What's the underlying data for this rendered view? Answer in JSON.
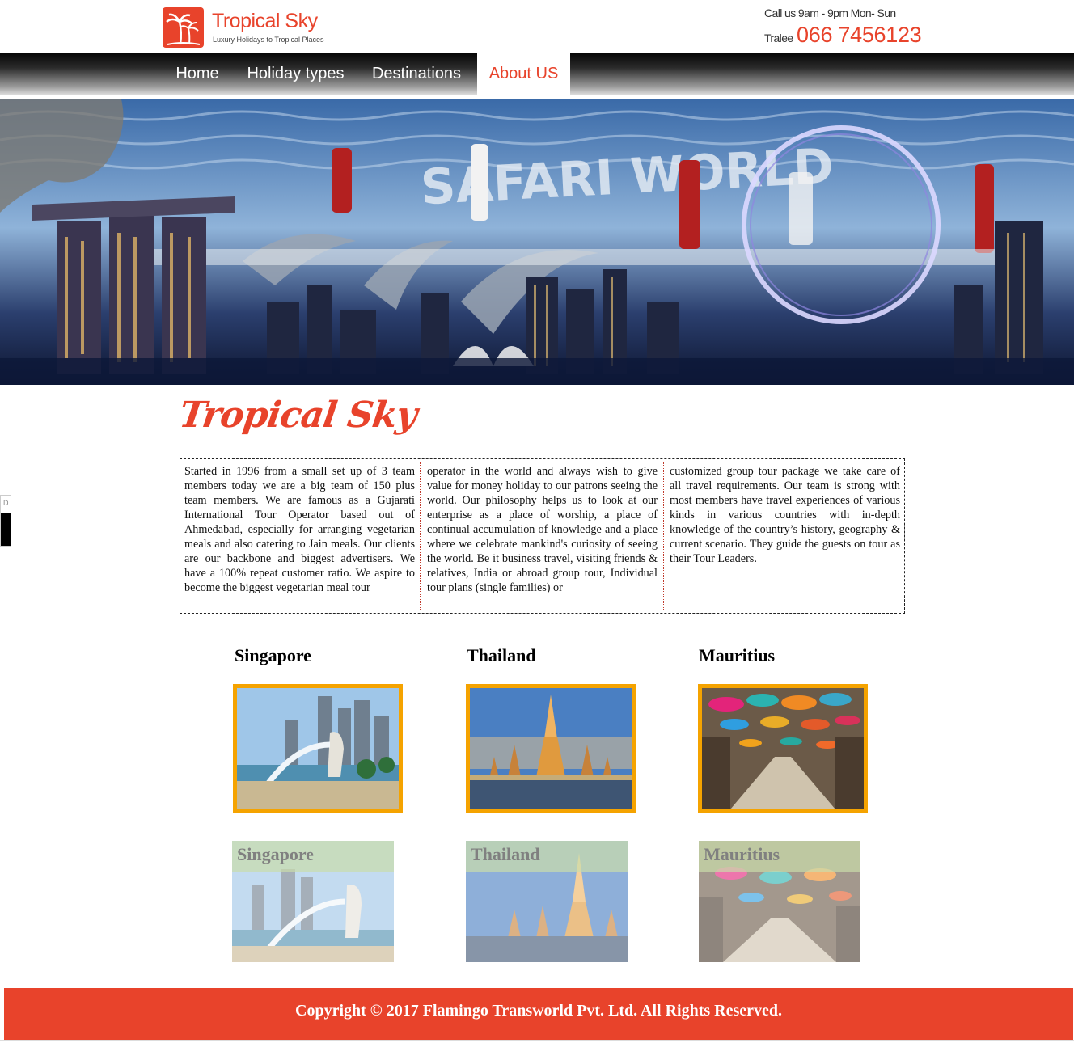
{
  "header": {
    "logo_title": "Tropical Sky",
    "logo_subtitle": "Luxury Holidays to Tropical Places",
    "call_hours": "Call us 9am - 9pm Mon- Sun",
    "phone_city": "Tralee",
    "phone_number": "066 7456123"
  },
  "nav": {
    "items": [
      {
        "label": "Home"
      },
      {
        "label": "Holiday types"
      },
      {
        "label": "Destinations"
      },
      {
        "label": "About US",
        "active": true
      }
    ]
  },
  "banner": {
    "overlay_text": "SAFARI WORLD"
  },
  "side_widget": {
    "label": "D"
  },
  "about": {
    "title": "Tropical Sky",
    "text_col1": "Started in 1996 from a small set up of 3 team members today we are a big team of 150 plus team members. We are famous as a Gujarati International Tour Operator based out of Ahmedabad, especially for arranging vegetarian meals and also catering to Jain meals. Our clients are our backbone and biggest advertisers. We have a 100% repeat customer ratio. We aspire to become the biggest vegetarian meal tour",
    "text_col2": "operator in the world and always wish to give value for money holiday to our patrons seeing the world. Our philosophy helps us to look at our enterprise as a place of worship, a place of continual accumulation of knowledge and a place where we celebrate mankind's curiosity of seeing the world. Be it business travel, visiting friends & relatives, India or abroad group tour, Individual tour plans (single families) or",
    "text_col3": "customized group tour package we take care of all travel requirements. Our team is strong with most members have travel experiences of various kinds in various countries with in-depth knowledge of the country’s history, geography & current scenario. They guide the guests on tour as their Tour Leaders."
  },
  "destinations": [
    {
      "name": "Singapore"
    },
    {
      "name": "Thailand"
    },
    {
      "name": "Mauritius"
    }
  ],
  "tiles": [
    {
      "label": "Singapore"
    },
    {
      "label": "Thailand"
    },
    {
      "label": "Mauritius"
    }
  ],
  "footer": {
    "text": "Copyright © 2017 Flamingo Transworld Pvt. Ltd. All Rights Reserved."
  },
  "colors": {
    "brand": "#e8432b",
    "frame": "#f5a300"
  }
}
